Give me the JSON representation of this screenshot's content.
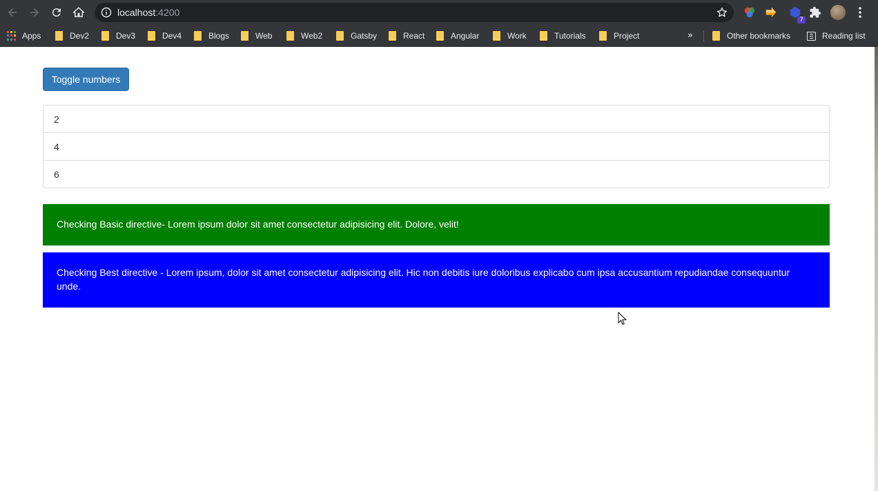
{
  "browser": {
    "url_host": "localhost",
    "url_port": ":4200",
    "extension_badge": "7",
    "bookmarks": [
      {
        "label": "Apps",
        "icon": "apps-grid-icon"
      },
      {
        "label": "Dev2",
        "icon": "folder-icon"
      },
      {
        "label": "Dev3",
        "icon": "folder-icon"
      },
      {
        "label": "Dev4",
        "icon": "folder-icon"
      },
      {
        "label": "Blogs",
        "icon": "folder-icon"
      },
      {
        "label": "Web",
        "icon": "folder-icon"
      },
      {
        "label": "Web2",
        "icon": "folder-icon"
      },
      {
        "label": "Gatsby",
        "icon": "folder-icon"
      },
      {
        "label": "React",
        "icon": "folder-icon"
      },
      {
        "label": "Angular",
        "icon": "folder-icon"
      },
      {
        "label": "Work",
        "icon": "folder-icon"
      },
      {
        "label": "Tutorials",
        "icon": "folder-icon"
      },
      {
        "label": "Project",
        "icon": "folder-icon"
      }
    ],
    "overflow_label": "»",
    "other_bookmarks": "Other bookmarks",
    "reading_list": "Reading list"
  },
  "page": {
    "toggle_button": "Toggle numbers",
    "numbers": [
      "2",
      "4",
      "6"
    ],
    "basic_directive": "Checking Basic directive- Lorem ipsum dolor sit amet consectetur adipisicing elit. Dolore, velit!",
    "best_directive": "Checking Best directive - Lorem ipsum, dolor sit amet consectetur adipisicing elit. Hic non debitis iure doloribus explicabo cum ipsa accusantium repudiandae consequuntur unde."
  },
  "colors": {
    "primary_button": "#337ab7",
    "basic_directive_bg": "#008000",
    "best_directive_bg": "#0000ff",
    "chrome_toolbar": "#35363a",
    "omnibox": "#202124"
  }
}
